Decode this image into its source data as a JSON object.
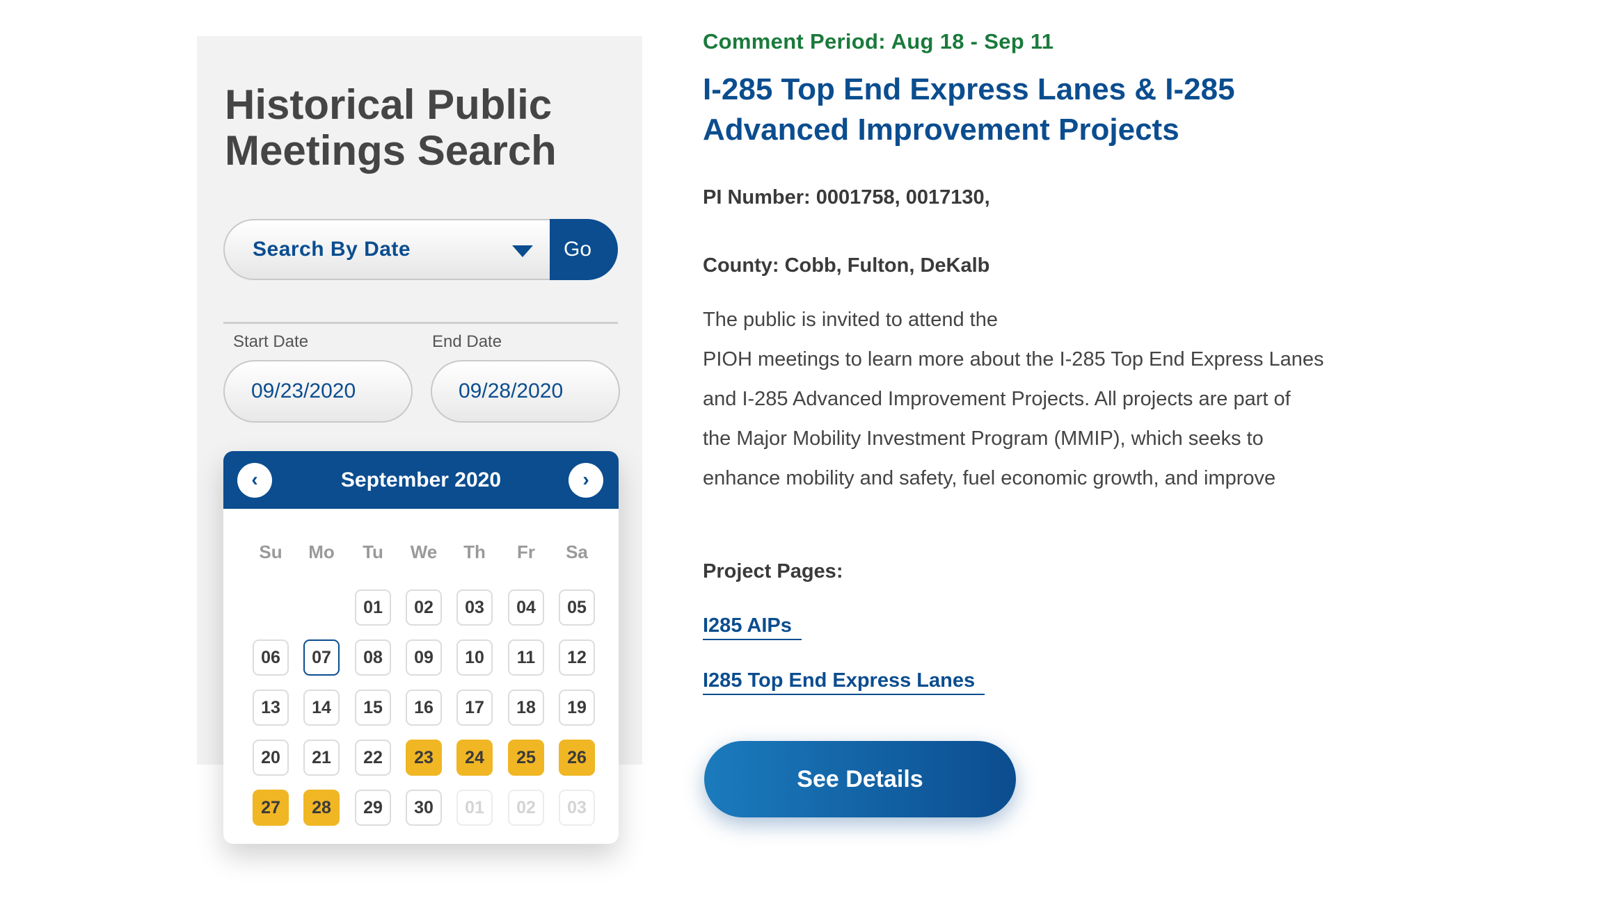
{
  "search_panel": {
    "title": "Historical Public Meetings Search",
    "search_select_value": "Search By Date",
    "go_label": "Go",
    "start_date_label": "Start Date",
    "start_date_value": "09/23/2020",
    "end_date_label": "End Date",
    "end_date_value": "09/28/2020"
  },
  "calendar": {
    "month_label": "September 2020",
    "prev_icon": "chevron-left-icon",
    "next_icon": "chevron-right-icon",
    "weekdays": [
      "Su",
      "Mo",
      "Tu",
      "We",
      "Th",
      "Fr",
      "Sa"
    ],
    "weeks": [
      [
        null,
        null,
        "01",
        "02",
        "03",
        "04",
        "05"
      ],
      [
        "06",
        "07",
        "08",
        "09",
        "10",
        "11",
        "12"
      ],
      [
        "13",
        "14",
        "15",
        "16",
        "17",
        "18",
        "19"
      ],
      [
        "20",
        "21",
        "22",
        "23",
        "24",
        "25",
        "26"
      ],
      [
        "27",
        "28",
        "29",
        "30",
        "01",
        "02",
        "03"
      ]
    ],
    "today": "07",
    "selected": [
      "23",
      "24",
      "25",
      "26",
      "27",
      "28"
    ],
    "next_month_days": [
      "01",
      "02",
      "03"
    ],
    "colors": {
      "accent": "#0b4d8f",
      "selected": "#f0b624"
    }
  },
  "meeting": {
    "comment_period": "Comment Period: Aug 18 - Sep 11",
    "title": "I-285 Top End Express Lanes & I-285 Advanced Improvement Projects",
    "pi_number": "PI Number: 0001758, 0017130,",
    "county": "County: Cobb, Fulton, DeKalb",
    "description_lines": [
      "The public is invited to attend the",
      "PIOH meetings to learn more about the I-285 Top End Express Lanes",
      "and I-285 Advanced Improvement Projects.  All projects are part of",
      "the Major Mobility Investment Program (MMIP), which seeks to",
      "enhance mobility and safety, fuel economic growth, and improve"
    ],
    "project_pages_label": "Project Pages:",
    "links": [
      "I285 AIPs",
      "I285 Top End Express Lanes"
    ],
    "see_details_label": "See Details",
    "colors": {
      "green": "#1a7a3c",
      "blue": "#0b4d8f"
    }
  }
}
